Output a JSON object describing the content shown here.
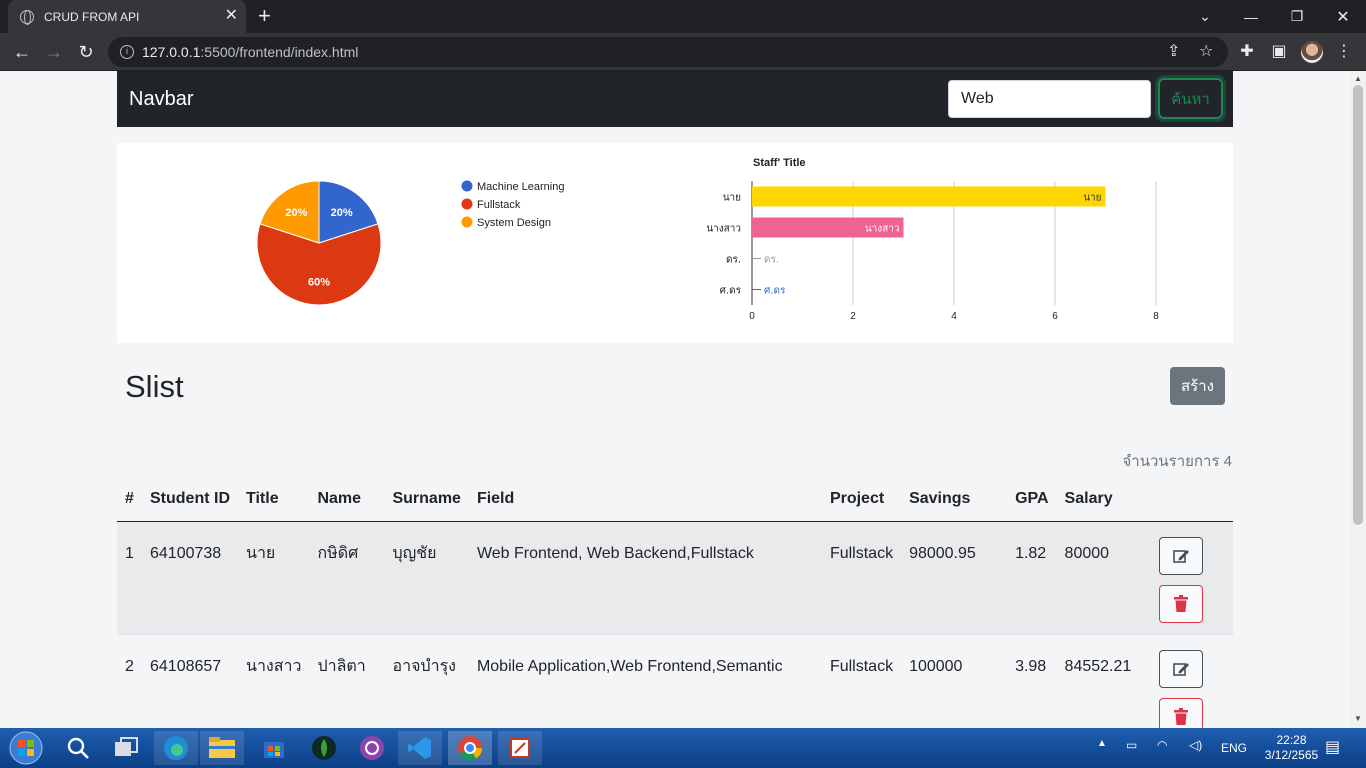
{
  "browser": {
    "tab_title": "CRUD FROM API",
    "url_host": "127.0.0.1",
    "url_rest": ":5500/frontend/index.html"
  },
  "navbar": {
    "brand": "Navbar",
    "search_value": "Web",
    "search_button": "ค้นหา"
  },
  "chart_data": [
    {
      "type": "pie",
      "categories": [
        "Machine Learning",
        "Fullstack",
        "System Design"
      ],
      "values": [
        20,
        60,
        20
      ],
      "labels": [
        "20%",
        "60%",
        "20%"
      ],
      "colors": [
        "#3366cc",
        "#dc3912",
        "#ff9900"
      ],
      "legend": "right"
    },
    {
      "type": "bar",
      "orientation": "horizontal",
      "title": "Staff' Title",
      "categories": [
        "นาย",
        "นางสาว",
        "ดร.",
        "ศ.ดร"
      ],
      "values": [
        7,
        3,
        0,
        0
      ],
      "colors": [
        "#ffd700",
        "#f06292",
        "#999999",
        "#3366cc"
      ],
      "xlim": [
        0,
        8
      ],
      "xticks": [
        "0",
        "2",
        "4",
        "6",
        "8"
      ],
      "grid": true
    }
  ],
  "main": {
    "title": "Slist",
    "create_button": "สร้าง",
    "count_text": "จำนวนรายการ 4"
  },
  "table": {
    "headers": [
      "#",
      "Student ID",
      "Title",
      "Name",
      "Surname",
      "Field",
      "Project",
      "Savings",
      "GPA",
      "Salary"
    ],
    "rows": [
      {
        "no": "1",
        "student_id": "64100738",
        "title": "นาย",
        "name": "กษิดิศ",
        "surname": "บุญชัย",
        "field": "Web Frontend, Web Backend,Fullstack",
        "project": "Fullstack",
        "savings": "98000.95",
        "gpa": "1.82",
        "salary": "80000"
      },
      {
        "no": "2",
        "student_id": "64108657",
        "title": "นางสาว",
        "name": "ปาลิตา",
        "surname": "อาจบำรุง",
        "field": "Mobile Application,Web Frontend,Semantic",
        "project": "Fullstack",
        "savings": "100000",
        "gpa": "3.98",
        "salary": "84552.21"
      }
    ]
  },
  "taskbar": {
    "lang": "ENG",
    "time": "22:28",
    "date": "3/12/2565"
  }
}
